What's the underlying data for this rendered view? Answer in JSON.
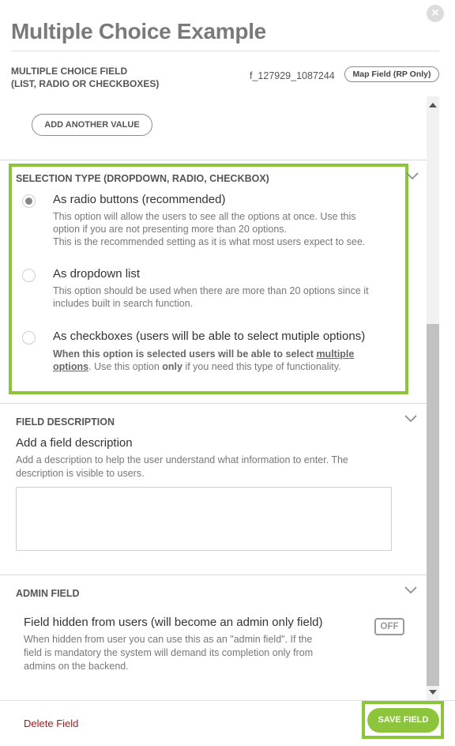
{
  "dialog": {
    "title": "Multiple Choice Example",
    "close_icon": "close-icon"
  },
  "field_info": {
    "type_line1": "MULTIPLE CHOICE FIELD",
    "type_line2": "(LIST, RADIO OR CHECKBOXES)",
    "field_id": "f_127929_1087244",
    "map_field_label": "Map Field (RP Only)"
  },
  "values": {
    "add_another_label": "ADD ANOTHER VALUE"
  },
  "selection_type": {
    "heading": "SELECTION TYPE (DROPDOWN, RADIO, CHECKBOX)",
    "options": [
      {
        "label": "As radio buttons (recommended)",
        "selected": true,
        "desc_line1": "This option will allow the users to see all the options at once. Use this",
        "desc_line2": "option if you are not presenting more than 20 options.",
        "desc_line3": "This is the recommended setting as it is what most users expect to see."
      },
      {
        "label": "As dropdown list",
        "selected": false,
        "desc_line1": "This option should be used when there are more than 20 options since it",
        "desc_line2": "includes built in search function."
      },
      {
        "label": "As checkboxes (users will be able to select mutiple options)",
        "selected": false,
        "desc_bold1": "When this option is selected users will be able to select",
        "desc_link1": "multiple",
        "desc_link2": "options",
        "desc_rest1": ". Use this option",
        "desc_bold2": "only",
        "desc_rest2": "if you need this type of functionality."
      }
    ]
  },
  "field_description": {
    "heading": "FIELD DESCRIPTION",
    "title": "Add a field description",
    "desc_line1": "Add a description to help the user understand what information to enter. The",
    "desc_line2": "description is visible to users.",
    "value": ""
  },
  "admin_field": {
    "heading": "ADMIN FIELD",
    "title": "Field hidden from users (will become an admin only field)",
    "desc_line1": "When hidden from user you can use this as an \"admin field\". If the",
    "desc_line2": "field is mandatory the system will demand its completion only from",
    "desc_line3": "admins on the backend.",
    "toggle_label": "OFF"
  },
  "footer": {
    "delete_label": "Delete Field",
    "save_label": "SAVE FIELD"
  },
  "colors": {
    "accent": "#8cc43c",
    "danger": "#9b1b1b",
    "title": "#7a7a7a"
  }
}
